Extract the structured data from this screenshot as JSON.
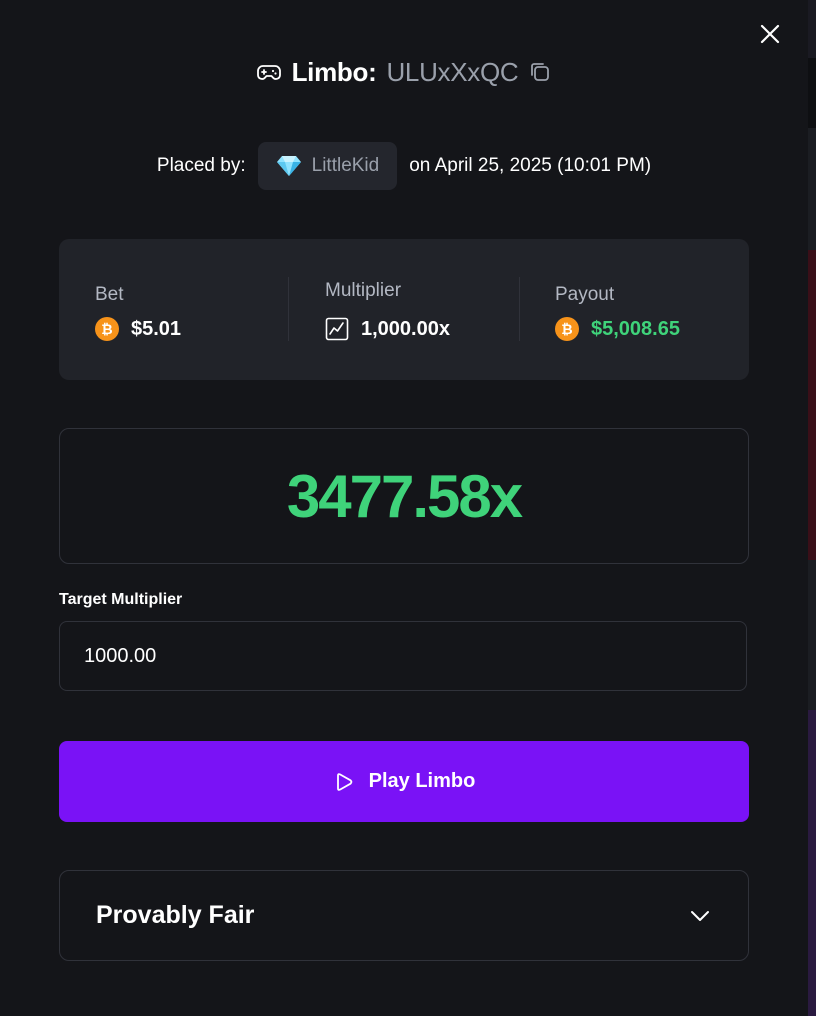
{
  "header": {
    "game_name": "Limbo:",
    "bet_id": "ULUxXxQC"
  },
  "placed": {
    "prefix": "Placed by:",
    "username": "LittleKid",
    "date_text": "on April 25, 2025 (10:01 PM)"
  },
  "stats": {
    "bet": {
      "label": "Bet",
      "value": "$5.01"
    },
    "multiplier": {
      "label": "Multiplier",
      "value": "1,000.00x"
    },
    "payout": {
      "label": "Payout",
      "value": "$5,008.65"
    }
  },
  "result": {
    "value": "3477.58x"
  },
  "target": {
    "label": "Target Multiplier",
    "value": "1000.00"
  },
  "play_button": {
    "label": "Play Limbo"
  },
  "provably_fair": {
    "title": "Provably Fair"
  },
  "colors": {
    "accent": "#7a12f6",
    "win_green": "#3fd37a",
    "coin_orange": "#f7931a"
  },
  "icons": [
    "close-icon",
    "gamepad-icon",
    "copy-icon",
    "diamond-icon",
    "bitcoin-icon",
    "trend-chart-icon",
    "play-icon",
    "chevron-down-icon"
  ]
}
